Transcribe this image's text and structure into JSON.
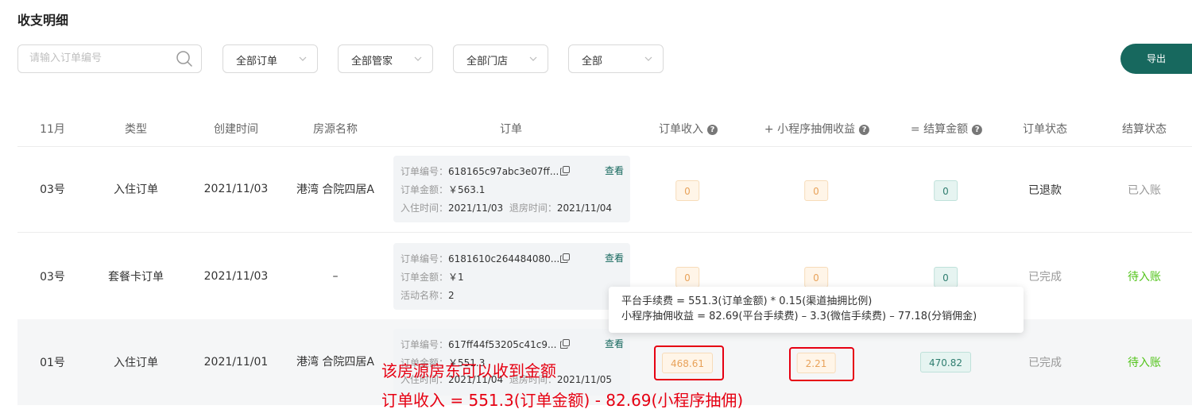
{
  "page_title": "收支明细",
  "filters": {
    "search_placeholder": "请输入订单编号",
    "selects": [
      "全部订单",
      "全部管家",
      "全部门店",
      "全部"
    ],
    "export_label": "导出"
  },
  "table": {
    "headers": [
      "11月",
      "类型",
      "创建时间",
      "房源名称",
      "订单",
      "订单收入",
      "+ 小程序抽佣收益",
      "= 结算金额",
      "订单状态",
      "结算状态"
    ],
    "help_icon": "?",
    "rows": [
      {
        "day": "03号",
        "type": "入住订单",
        "created": "2021/11/03",
        "property": "港湾 合院四居A",
        "order": {
          "line1_label": "订单编号：",
          "line1_value": "618165c97abc3e07ff...",
          "line2_label": "订单金额：",
          "line2_value": "￥563.1",
          "line3_label": "入住时间：",
          "line3_value": "2021/11/03",
          "line3b_label": "退房时间：",
          "line3b_value": "2021/11/04",
          "view": "查看"
        },
        "income": "0",
        "commission": "0",
        "settlement": "0",
        "order_status": "已退款",
        "settle_status": "已入账"
      },
      {
        "day": "03号",
        "type": "套餐卡订单",
        "created": "2021/11/03",
        "property": "–",
        "order": {
          "line1_label": "订单编号：",
          "line1_value": "6181610c264484080...",
          "line2_label": "订单金额：",
          "line2_value": "￥1",
          "line3_label": "活动名称：",
          "line3_value": "2",
          "view": "查看"
        },
        "income": "0",
        "commission": "0",
        "settlement": "0",
        "order_status": "已完成",
        "settle_status": "待入账"
      },
      {
        "day": "01号",
        "type": "入住订单",
        "created": "2021/11/01",
        "property": "港湾 合院四居A",
        "order": {
          "line1_label": "订单编号：",
          "line1_value": "617ff44f53205c41c9...",
          "line2_label": "订单金额：",
          "line2_value": "￥551.3",
          "line3_label": "入住时间：",
          "line3_value": "2021/11/04",
          "line3b_label": "退房时间：",
          "line3b_value": "2021/11/05",
          "view": "查看"
        },
        "income": "468.61",
        "commission": "2.21",
        "settlement": "470.82",
        "order_status": "已完成",
        "settle_status": "待入账"
      }
    ]
  },
  "tooltip": {
    "line1": "平台手续费 = 551.3(订单金额) * 0.15(渠道抽拥比例)",
    "line2": "小程序抽佣收益 = 82.69(平台手续费) – 3.3(微信手续费) – 77.18(分销佣金)"
  },
  "annotations": {
    "line1": "该房源房东可以收到金额",
    "line2": "订单收入 = 551.3(订单金额) - 82.69(小程序抽佣)"
  },
  "colors": {
    "accent": "#17685e",
    "annotation_red": "#e60012",
    "pending_green": "#52c41a"
  }
}
